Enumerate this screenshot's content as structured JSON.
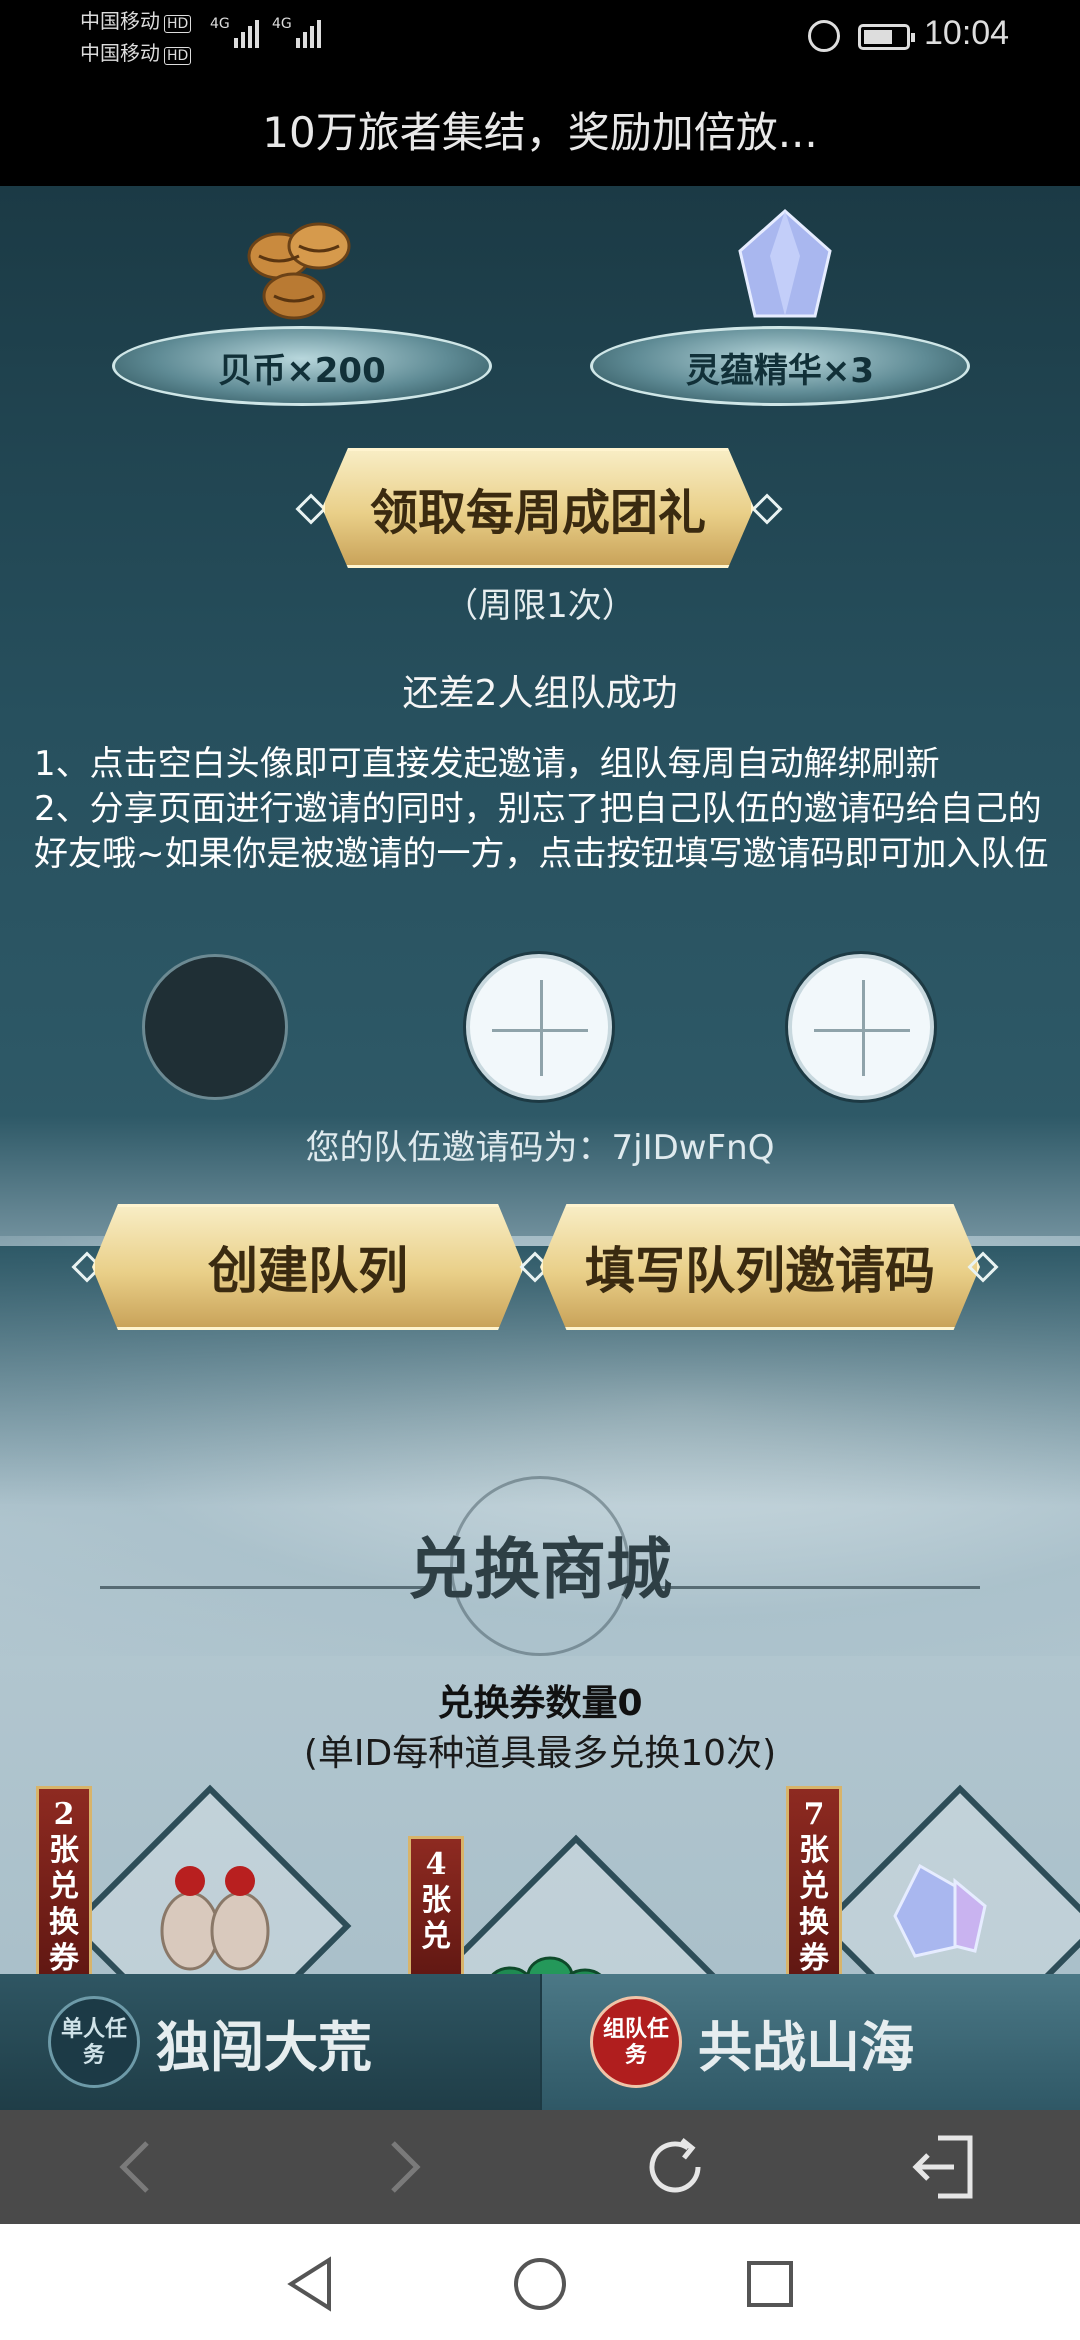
{
  "status_bar": {
    "carrier_1": "中国移动",
    "carrier_2": "中国移动",
    "hd": "HD",
    "net_1": "4G",
    "net_2": "4G",
    "battery_level": 0.7,
    "time": "10:04"
  },
  "page": {
    "title": "10万旅者集结，奖励加倍放..."
  },
  "rewards": {
    "items": [
      {
        "label": "贝币×200",
        "icon": "cowrie-shells-icon"
      },
      {
        "label": "灵蕴精华×3",
        "icon": "crystal-icon"
      }
    ],
    "claim_button": "领取每周成团礼",
    "limit_note": "（周限1次）"
  },
  "team": {
    "status": "还差2人组队成功",
    "rules": [
      "1、点击空白头像即可直接发起邀请，组队每周自动解绑刷新",
      "2、分享页面进行邀请的同时，别忘了把自己队伍的邀请码给自己的好友哦~如果你是被邀请的一方，点击按钮填写邀请码即可加入队伍"
    ],
    "invite_code_text": "您的队伍邀请码为：7jIDwFnQ",
    "create_button": "创建队列",
    "enter_code_button": "填写队列邀请码"
  },
  "shop": {
    "title": "兑换商城",
    "voucher_count": "兑换券数量0",
    "note": "(单ID每种道具最多兑换10次)",
    "items": [
      {
        "tag": "2张兑换券",
        "icon": "vase-icon"
      },
      {
        "tag": "4张兑",
        "icon": "jade-beads-icon"
      },
      {
        "tag": "7张兑换券",
        "icon": "crystal-icon"
      }
    ]
  },
  "tabs": [
    {
      "badge": "单人任务",
      "label": "独闯大荒"
    },
    {
      "badge": "组队任务",
      "label": "共战山海"
    }
  ],
  "colors": {
    "accent_gold": "#e9cf88",
    "tab_red": "#b01e1e",
    "sea_dark": "#1b3a45"
  }
}
